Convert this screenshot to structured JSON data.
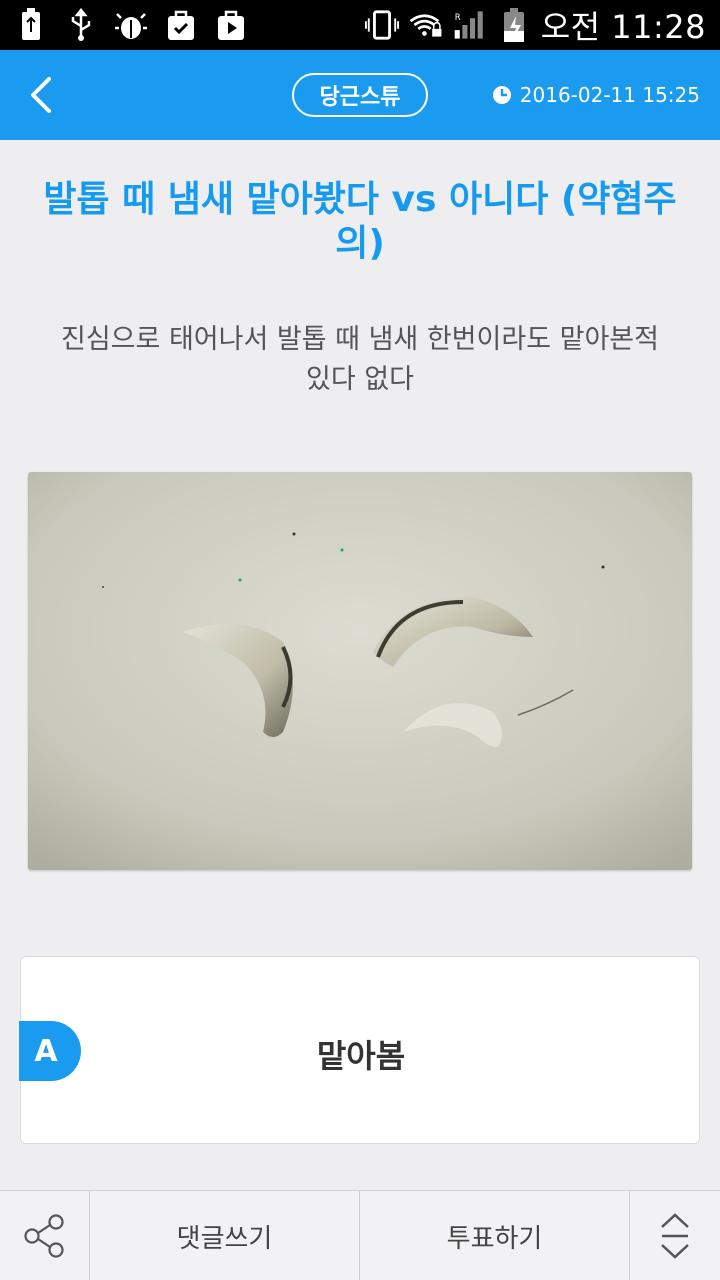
{
  "status_bar": {
    "time": "오전 11:28",
    "left_icons": [
      "battery-saver-icon",
      "usb-icon",
      "android-debug-icon",
      "shopping-bag-icon",
      "play-store-icon"
    ],
    "right_icons": [
      "vibrate-icon",
      "wifi-lock-icon",
      "signal-icon",
      "battery-charging-icon"
    ]
  },
  "appbar": {
    "category": "당근스튜",
    "date": "2016-02-11 15:25",
    "accent_color": "#1a9bf0"
  },
  "post": {
    "title": "발톱 때 냄새 맡아봤다 vs 아니다 (약혐주의)",
    "subtitle": "진심으로 태어나서 발톱 때 냄새 한번이라도 맡아본적 있다 없다"
  },
  "options": [
    {
      "letter": "A",
      "label": "맡아봄"
    }
  ],
  "bottom_bar": {
    "share_icon": "share-icon",
    "comment_label": "댓글쓰기",
    "vote_label": "투표하기",
    "scroll_icon": "expand-collapse-icon"
  }
}
